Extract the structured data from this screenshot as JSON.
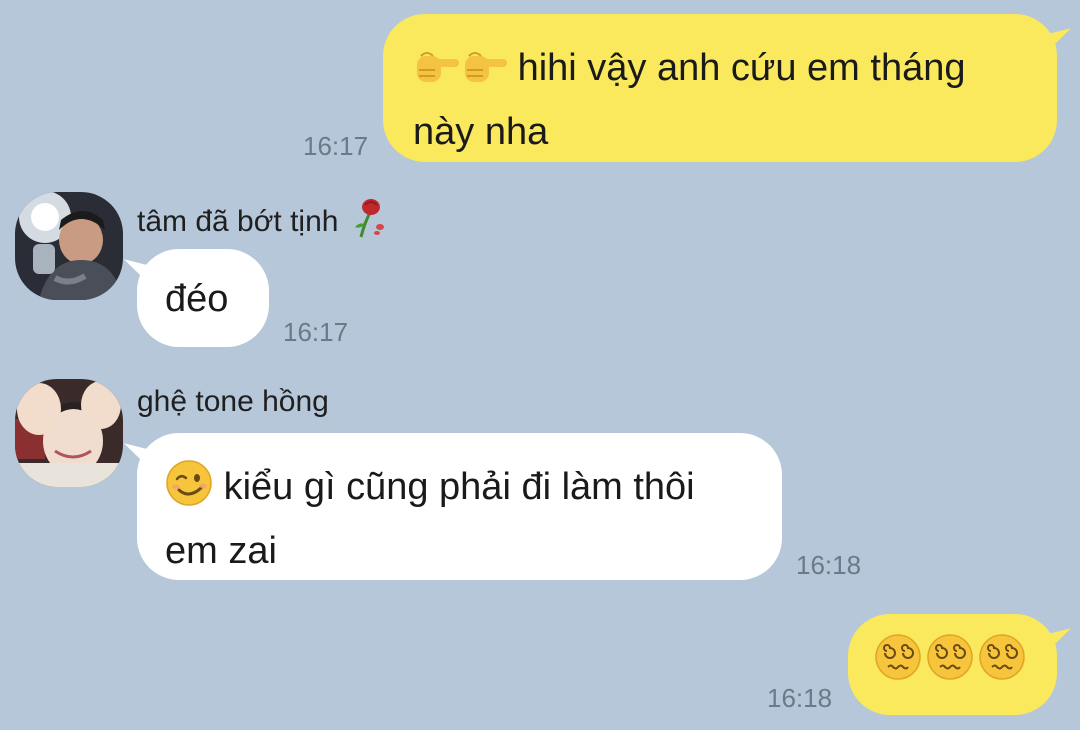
{
  "chat": {
    "messages": [
      {
        "direction": "sent",
        "prefix_emoji": "pointing-hands",
        "text_line1": "hihi vậy anh cứu em tháng",
        "text_line2": "này nha",
        "time": "16:17"
      },
      {
        "direction": "received",
        "sender": "tâm đã bớt tịnh",
        "sender_emoji": "wilted-rose",
        "text": "đéo",
        "time": "16:17"
      },
      {
        "direction": "received",
        "sender": "ghệ tone hồng",
        "prefix_emoji": "winking-face",
        "text_line1": "kiểu gì cũng phải đi làm thôi",
        "text_line2": "em zai",
        "time": "16:18"
      },
      {
        "direction": "sent",
        "emojis": [
          "dizzy-face",
          "dizzy-face",
          "dizzy-face"
        ],
        "time": "16:18"
      }
    ]
  },
  "colors": {
    "background": "#b6c7d9",
    "sent_bubble": "#fbe95d",
    "received_bubble": "#ffffff",
    "timestamp": "#6b7a8a"
  }
}
